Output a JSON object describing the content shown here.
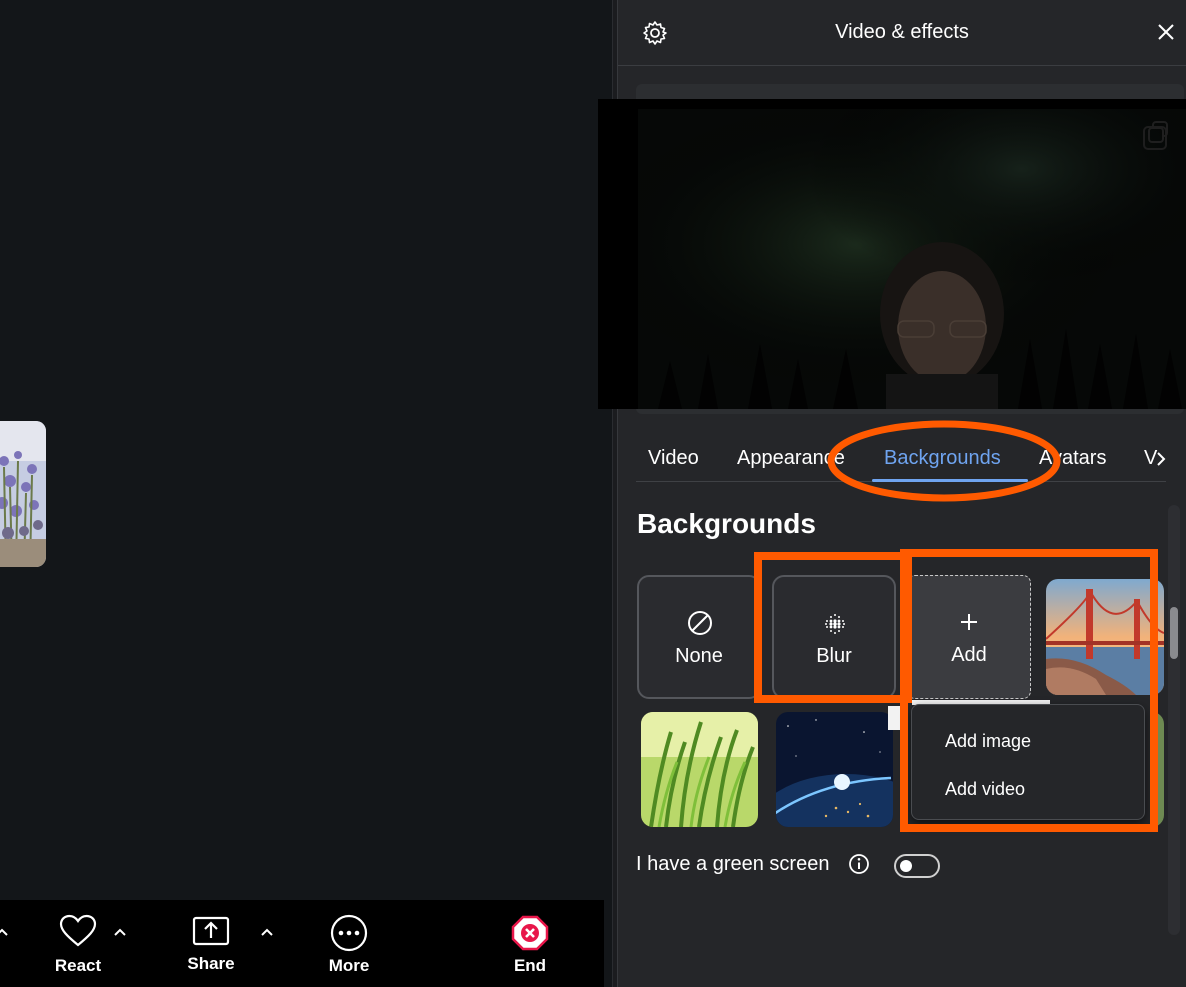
{
  "panel": {
    "title": "Video & effects",
    "settings_icon": "gear-icon",
    "close_icon": "close-icon"
  },
  "tabs": [
    {
      "label": "Video",
      "active": false
    },
    {
      "label": "Appearance",
      "active": false
    },
    {
      "label": "Backgrounds",
      "active": true
    },
    {
      "label": "Avatars",
      "active": false
    },
    {
      "label": "V",
      "active": false
    }
  ],
  "section": {
    "title": "Backgrounds"
  },
  "tiles": {
    "none": {
      "label": "None",
      "icon": "no-symbol-icon"
    },
    "blur": {
      "label": "Blur",
      "icon": "blur-dots-icon"
    },
    "add": {
      "label": "Add",
      "icon": "plus-icon"
    }
  },
  "add_menu": {
    "items": [
      "Add image",
      "Add video"
    ]
  },
  "green_screen": {
    "label": "I have a green screen",
    "enabled": false
  },
  "toolbar": {
    "react": "React",
    "share": "Share",
    "more": "More",
    "end": "End"
  },
  "colors": {
    "accent": "#6fa4f0",
    "annotation": "#ff5a00",
    "end_red": "#e8164a",
    "panel_bg": "#252629"
  }
}
